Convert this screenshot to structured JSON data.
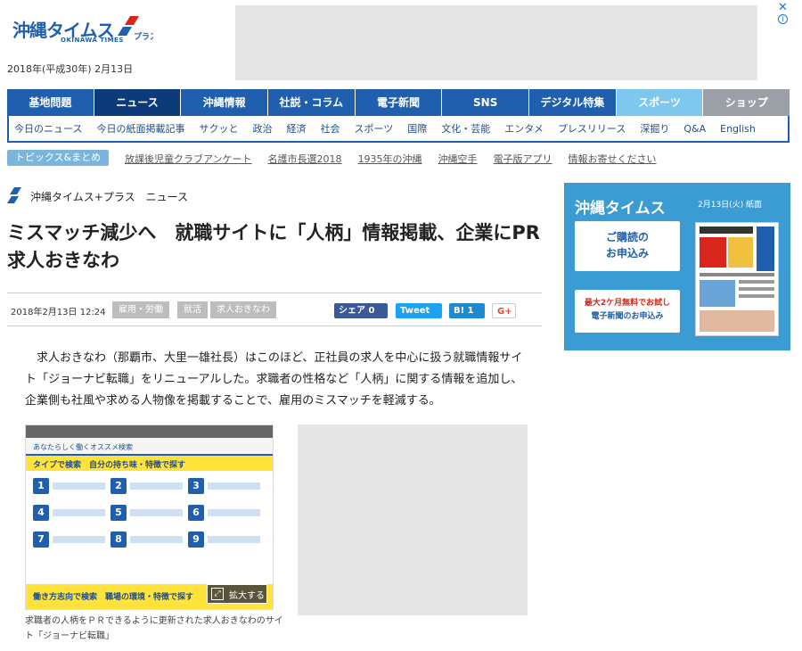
{
  "header": {
    "logo_text": "沖縄タイムス",
    "logo_plus": "プラス",
    "logo_sub": "OKINAWA TIMES",
    "date": "2018年(平成30年) 2月13日"
  },
  "main_nav": [
    "基地問題",
    "ニュース",
    "沖縄情報",
    "社説・コラム",
    "電子新聞",
    "SNS",
    "デジタル特集",
    "スポーツ",
    "ショップ"
  ],
  "sub_nav": [
    "今日のニュース",
    "今日の紙面掲載記事",
    "サクッと",
    "政治",
    "経済",
    "社会",
    "スポーツ",
    "国際",
    "文化・芸能",
    "エンタメ",
    "プレスリリース",
    "深掘り",
    "Q&A",
    "English"
  ],
  "topics": {
    "badge": "トピックス&まとめ",
    "items": [
      "放課後児童クラブアンケート",
      "名護市長選2018",
      "1935年の沖縄",
      "沖縄空手",
      "電子版アプリ",
      "情報お寄せください"
    ]
  },
  "article": {
    "section": "沖縄タイムス+プラス　ニュース",
    "title": "ミスマッチ減少へ　就職サイトに「人柄」情報掲載、企業にPR　求人おきなわ",
    "date": "2018年2月13日 12:24",
    "tags": [
      "雇用・労働",
      "就活",
      "求人おきなわ"
    ],
    "share": {
      "facebook": "シェア 0",
      "twitter": "Tweet",
      "hatena": "B! 1",
      "gplus": "G+"
    },
    "body": "求人おきなわ（那覇市、大里一雄社長）はこのほど、正社員の求人を中心に扱う就職情報サイト「ジョーナビ転職」をリニューアルした。求職者の性格など「人柄」に関する情報を追加し、企業側も社風や求める人物像を掲載することで、雇用のミスマッチを軽減する。",
    "image": {
      "title": "あなたらしく働くオススメ検索",
      "band": "タイプで検索　自分の持ち味・特徴で探す",
      "numbers": [
        "1",
        "2",
        "3",
        "4",
        "5",
        "6",
        "7",
        "8",
        "9"
      ],
      "bottom_band": "働き方志向で検索　職場の環境・特徴で探す",
      "enlarge": "拡大する",
      "caption": "求職者の人柄をＰＲできるように更新された求人おきなわのサイト「ジョーナビ転職」"
    }
  },
  "sidebar": {
    "logo": "沖縄タイムス",
    "date": "2月13日(火) 紙面",
    "subscribe_line1": "ご購読の",
    "subscribe_line2": "お申込み",
    "trial_line1": "最大2ケ月無料でお試し",
    "trial_line2": "電子新聞のお申込み"
  },
  "colors": {
    "brand": "#1f5fae",
    "nav_active": "#0d3b7a",
    "sports": "#7ec8ef",
    "shop": "#9aa0a6",
    "sidebar": "#3b9bd3"
  }
}
